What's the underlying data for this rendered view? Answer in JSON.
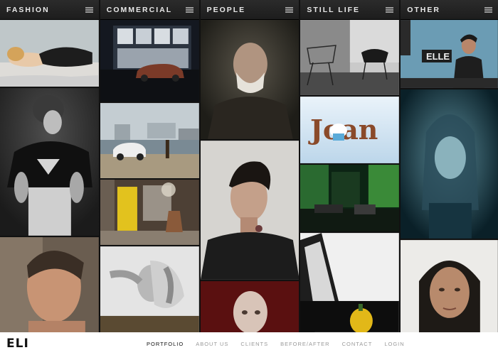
{
  "columns": [
    {
      "id": "fashion",
      "title": "FASHION",
      "tiles": [
        {
          "label": "photo-woman-reclining-lace",
          "bg": "#c9c6c0"
        },
        {
          "label": "photo-woman-black-jacket",
          "bg": "#2a2a2a"
        },
        {
          "label": "photo-man-portrait-older",
          "bg": "#4a4038"
        }
      ]
    },
    {
      "id": "commercial",
      "title": "COMMERCIAL",
      "tiles": [
        {
          "label": "photo-storefront-car-night",
          "bg": "#1e2430"
        },
        {
          "label": "photo-mini-car-waterfront",
          "bg": "#aab5b8"
        },
        {
          "label": "photo-interior-yellow-shelf",
          "bg": "#5a4a3a"
        },
        {
          "label": "photo-woman-hands-hair",
          "bg": "#e0e0e0"
        }
      ]
    },
    {
      "id": "people",
      "title": "PEOPLE",
      "tiles": [
        {
          "label": "photo-old-man-bearded",
          "bg": "#3c3a33"
        },
        {
          "label": "photo-young-man-tattoo",
          "bg": "#d2d0cc"
        },
        {
          "label": "photo-bald-man-red",
          "bg": "#5a1212"
        }
      ]
    },
    {
      "id": "still-life",
      "title": "STILL LIFE",
      "tiles": [
        {
          "label": "photo-wire-chairs",
          "bg": "#9a9a9a"
        },
        {
          "label": "photo-joan-typography",
          "bg": "#d8e8f4"
        },
        {
          "label": "photo-green-room",
          "bg": "#0f2a18"
        },
        {
          "label": "photo-monitor-pepper",
          "bg": "#f2f2f2"
        }
      ]
    },
    {
      "id": "other",
      "title": "OTHER",
      "tiles": [
        {
          "label": "photo-woman-elle-sign",
          "bg": "#4a7a90"
        },
        {
          "label": "photo-woman-blue-blur",
          "bg": "#0f3440"
        },
        {
          "label": "photo-woman-portrait-light",
          "bg": "#e8e6e2"
        }
      ]
    }
  ],
  "tile_text": {
    "joan": "Joan",
    "elle": "ELLE"
  },
  "footer": {
    "logo": "ELI",
    "nav": [
      {
        "label": "PORTFOLIO",
        "active": true
      },
      {
        "label": "ABOUT US",
        "active": false
      },
      {
        "label": "CLIENTS",
        "active": false
      },
      {
        "label": "BEFORE/AFTER",
        "active": false
      },
      {
        "label": "CONTACT",
        "active": false
      },
      {
        "label": "LOGIN",
        "active": false
      }
    ]
  }
}
